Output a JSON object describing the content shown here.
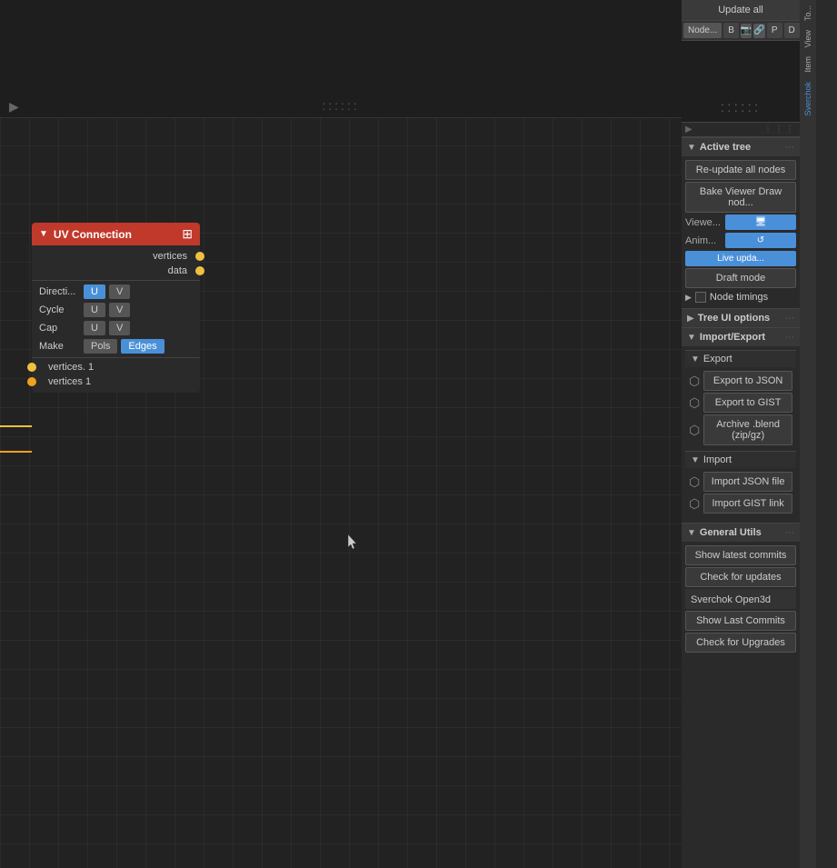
{
  "header": {
    "update_all": "Update all"
  },
  "tabs": {
    "node_label": "Node...",
    "b_label": "B",
    "p_label": "P",
    "d_label": "D"
  },
  "active_tree": {
    "title": "Active tree",
    "re_update_btn": "Re-update all nodes",
    "bake_viewer_btn": "Bake Viewer Draw nod...",
    "viewer_label": "Viewe...",
    "anim_label": "Anim...",
    "live_update_btn": "Live upda...",
    "draft_mode_btn": "Draft mode",
    "node_timings_label": "Node timings"
  },
  "tree_ui_options": {
    "title": "Tree UI options"
  },
  "import_export": {
    "title": "Import/Export",
    "export_section": "Export",
    "export_json_btn": "Export to JSON",
    "export_gist_btn": "Export to GIST",
    "archive_btn": "Archive .blend (zip/gz)",
    "import_section": "Import",
    "import_json_btn": "Import JSON file",
    "import_gist_btn": "Import GIST link"
  },
  "general_utils": {
    "title": "General Utils",
    "show_latest_commits_btn": "Show latest commits",
    "check_for_updates_btn": "Check for updates",
    "sverchok_open3d_label": "Sverchok Open3d",
    "show_last_commits_btn": "Show Last Commits",
    "check_for_upgrades_btn": "Check for Upgrades"
  },
  "uv_node": {
    "title": "UV Connection",
    "vertices_label": "vertices",
    "data_label": "data",
    "direction_label": "Directi...",
    "u_btn": "U",
    "v_btn": "V",
    "cycle_label": "Cycle",
    "cap_label": "Cap",
    "make_label": "Make",
    "pols_btn": "Pols",
    "edges_btn": "Edges",
    "output1_label": "vertices. 1",
    "output2_label": "vertices 1"
  },
  "side_tabs": {
    "tool": "To...",
    "view": "View",
    "item": "Item",
    "sverchok": "Sverchok"
  }
}
